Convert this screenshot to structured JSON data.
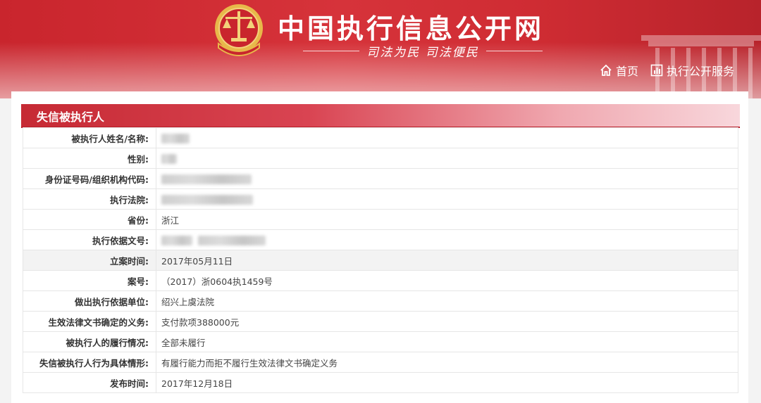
{
  "header": {
    "site_title": "中国执行信息公开网",
    "slogan": "司法为民  司法便民",
    "nav": [
      {
        "label": "首页",
        "icon": "home-icon"
      },
      {
        "label": "执行公开服务",
        "icon": "chart-icon"
      }
    ],
    "colors": {
      "brand_red": "#c9252d",
      "emblem_gold": "#e8b84a"
    }
  },
  "section": {
    "title": "失信被执行人"
  },
  "rows": [
    {
      "label": "被执行人姓名/名称:",
      "value": "",
      "redacted": true
    },
    {
      "label": "性别:",
      "value": "",
      "redacted": true
    },
    {
      "label": "身份证号码/组织机构代码:",
      "value": "",
      "redacted": true
    },
    {
      "label": "执行法院:",
      "value": "",
      "redacted": true
    },
    {
      "label": "省份:",
      "value": "浙江",
      "redacted": false
    },
    {
      "label": "执行依据文号:",
      "value": "",
      "redacted": true
    },
    {
      "label": "立案时间:",
      "value": "2017年05月11日",
      "redacted": false
    },
    {
      "label": "案号:",
      "value": "（2017）浙0604执1459号",
      "redacted": false
    },
    {
      "label": "做出执行依据单位:",
      "value": "绍兴上虞法院",
      "redacted": false
    },
    {
      "label": "生效法律文书确定的义务:",
      "value": "支付款项388000元",
      "redacted": false
    },
    {
      "label": "被执行人的履行情况:",
      "value": "全部未履行",
      "redacted": false
    },
    {
      "label": "失信被执行人行为具体情形:",
      "value": "有履行能力而拒不履行生效法律文书确定义务",
      "redacted": false
    },
    {
      "label": "发布时间:",
      "value": "2017年12月18日",
      "redacted": false
    }
  ]
}
